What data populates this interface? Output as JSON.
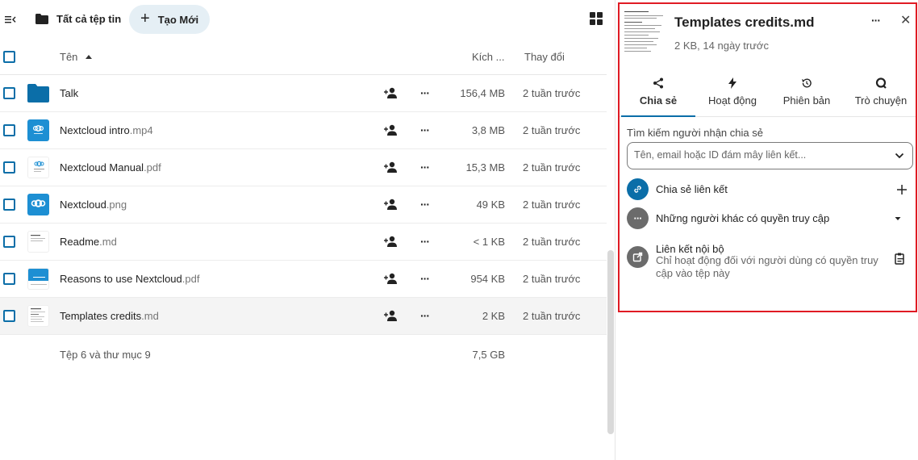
{
  "topbar": {
    "breadcrumb_label": "Tất cả tệp tin",
    "new_button_label": "Tạo Mới"
  },
  "list": {
    "header": {
      "name": "Tên",
      "size": "Kích ...",
      "modified": "Thay đổi"
    },
    "rows": [
      {
        "name": "Talk",
        "ext": "",
        "size": "156,4 MB",
        "modified": "2 tuần trước",
        "icon": "folder-icon"
      },
      {
        "name": "Nextcloud intro",
        "ext": ".mp4",
        "size": "3,8 MB",
        "modified": "2 tuần trước",
        "icon": "video-thumbnail"
      },
      {
        "name": "Nextcloud Manual",
        "ext": ".pdf",
        "size": "15,3 MB",
        "modified": "2 tuần trước",
        "icon": "pdf-thumbnail"
      },
      {
        "name": "Nextcloud",
        "ext": ".png",
        "size": "49 KB",
        "modified": "2 tuần trước",
        "icon": "image-thumbnail"
      },
      {
        "name": "Readme",
        "ext": ".md",
        "size": "< 1 KB",
        "modified": "2 tuần trước",
        "icon": "text-thumbnail"
      },
      {
        "name": "Reasons to use Nextcloud",
        "ext": ".pdf",
        "size": "954 KB",
        "modified": "2 tuần trước",
        "icon": "pdf-thumbnail"
      },
      {
        "name": "Templates credits",
        "ext": ".md",
        "size": "2 KB",
        "modified": "2 tuần trước",
        "icon": "text-thumbnail"
      }
    ],
    "summary": {
      "text": "Tệp 6 và thư mục 9",
      "size": "7,5 GB"
    }
  },
  "sidebar": {
    "title": "Templates credits.md",
    "subtitle": "2 KB, 14 ngày trước",
    "tabs": [
      {
        "label": "Chia sẻ",
        "icon": "share-icon",
        "active": true
      },
      {
        "label": "Hoạt động",
        "icon": "activity-icon",
        "active": false
      },
      {
        "label": "Phiên bản",
        "icon": "history-icon",
        "active": false
      },
      {
        "label": "Trò chuyện",
        "icon": "chat-icon",
        "active": false
      }
    ],
    "search_label": "Tìm kiếm người nhận chia sẻ",
    "search_placeholder": "Tên, email hoặc ID đám mây liên kết...",
    "share_link_label": "Chia sẻ liên kết",
    "others_access_label": "Những người khác có quyền truy cập",
    "internal_link_label": "Liên kết nội bộ",
    "internal_link_desc": "Chỉ hoạt động đối với người dùng có quyền truy cập vào tệp này"
  },
  "colors": {
    "accent": "#0b6ea8",
    "highlight_border": "#e01b24",
    "selected_row": "#f4f4f4"
  }
}
